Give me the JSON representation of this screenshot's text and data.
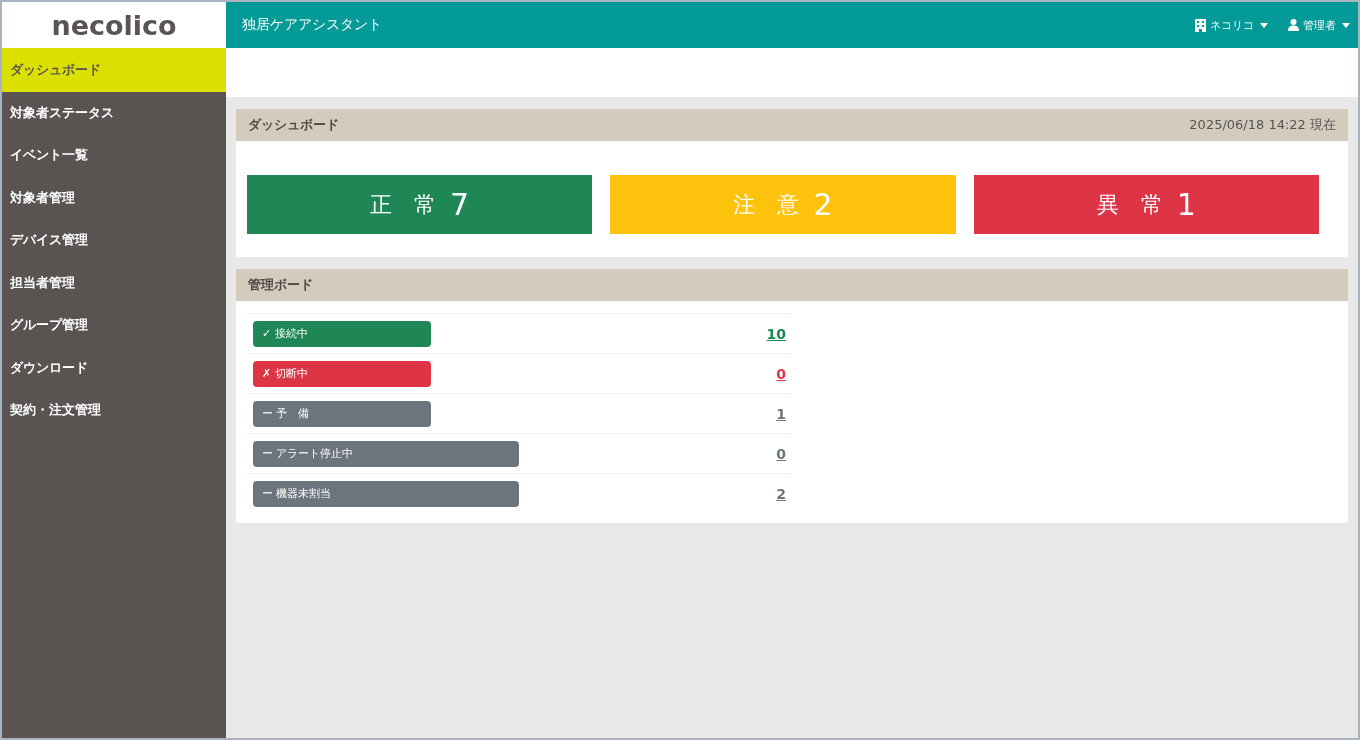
{
  "logo": "necolico",
  "header": {
    "title": "独居ケアアシスタント",
    "org_menu": "ネコリコ",
    "user_menu": "管理者"
  },
  "sidebar": {
    "items": [
      {
        "label": "ダッシュボード",
        "selected": true
      },
      {
        "label": "対象者ステータス",
        "selected": false
      },
      {
        "label": "イベント一覧",
        "selected": false
      },
      {
        "label": "対象者管理",
        "selected": false
      },
      {
        "label": "デバイス管理",
        "selected": false
      },
      {
        "label": "担当者管理",
        "selected": false
      },
      {
        "label": "グループ管理",
        "selected": false
      },
      {
        "label": "ダウンロード",
        "selected": false
      },
      {
        "label": "契約・注文管理",
        "selected": false
      }
    ]
  },
  "dashboard": {
    "title": "ダッシュボード",
    "timestamp": "2025/06/18 14:22 現在",
    "status_cards": [
      {
        "label": "正　常",
        "count": "7",
        "color": "#1e8755"
      },
      {
        "label": "注　意",
        "count": "2",
        "color": "#fdc20c"
      },
      {
        "label": "異　常",
        "count": "1",
        "color": "#dd3546"
      }
    ]
  },
  "management_board": {
    "title": "管理ボード",
    "rows": [
      {
        "label": "✓ 接続中",
        "count": "10",
        "color": "#1e8755",
        "kind": "short"
      },
      {
        "label": "✗ 切断中",
        "count": "0",
        "color": "#dd3546",
        "kind": "short"
      },
      {
        "label": "ー 予　備",
        "count": "1",
        "color": "#6c757d",
        "kind": "short"
      },
      {
        "label": "ー アラート停止中",
        "count": "0",
        "color": "#6c757d",
        "kind": "long"
      },
      {
        "label": "ー 機器未割当",
        "count": "2",
        "color": "#6c757d",
        "kind": "long"
      }
    ]
  }
}
